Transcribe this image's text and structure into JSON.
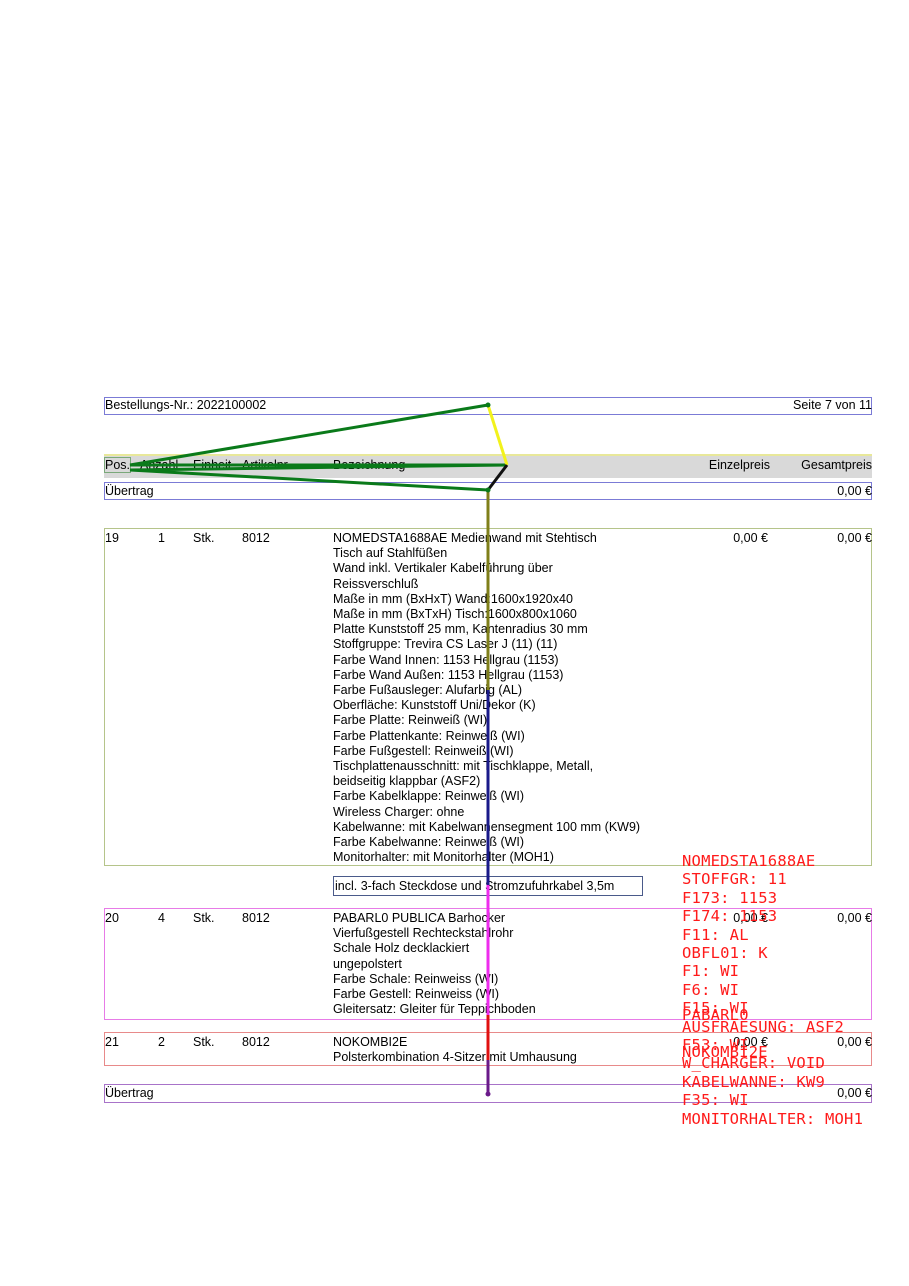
{
  "header": {
    "order_label": "Bestellungs-Nr.: 2022100002",
    "page_label": "Seite 7 von 11"
  },
  "table_header": {
    "pos": "Pos.",
    "anzahl": "Anzahl",
    "einheit": "Einheit",
    "artikelnr": "Artikelnr.",
    "bezeichnung": "Bezeichnung",
    "einzelpreis": "Einzelpreis",
    "gesamtpreis": "Gesamtpreis"
  },
  "carry_top": {
    "label": "Übertrag",
    "value": "0,00 €"
  },
  "items": [
    {
      "pos": "19",
      "qty": "1",
      "unit": "Stk.",
      "article": "8012",
      "unit_price": "0,00 €",
      "total": "0,00 €",
      "lines": [
        "NOMEDSTA1688AE Medienwand mit Stehtisch",
        "Tisch auf Stahlfüßen",
        "Wand inkl. Vertikaler Kabelführung über",
        "Reissverschluß",
        "Maße in mm (BxHxT) Wand:1600x1920x40",
        "Maße in mm (BxTxH) Tisch:1600x800x1060",
        "Platte Kunststoff 25 mm, Kantenradius 30 mm",
        "Stoffgruppe: Trevira CS Laser J (11) (11)",
        "Farbe Wand Innen: 1153 Hellgrau (1153)",
        "Farbe Wand Außen: 1153 Hellgrau (1153)",
        "Farbe Fußausleger: Alufarbig (AL)",
        "Oberfläche: Kunststoff Uni/Dekor (K)",
        "Farbe Platte: Reinweiß (WI)",
        "Farbe Plattenkante: Reinweiß (WI)",
        "Farbe Fußgestell: Reinweiß (WI)",
        "Tischplattenausschnitt: mit Tischklappe, Metall,",
        "beidseitig klappbar (ASF2)",
        "Farbe Kabelklappe: Reinweiß (WI)",
        "Wireless Charger: ohne",
        "Kabelwanne: mit Kabelwannensegment 100 mm (KW9)",
        "Farbe Kabelwanne: Reinweiß (WI)",
        "Monitorhalter: mit Monitorhalter (MOH1)"
      ],
      "note": "incl. 3-fach Steckdose und Stromzufuhrkabel 3,5m"
    },
    {
      "pos": "20",
      "qty": "4",
      "unit": "Stk.",
      "article": "8012",
      "unit_price": "0,00 €",
      "total": "0,00 €",
      "lines": [
        "PABARL0 PUBLICA Barhocker",
        "Vierfußgestell Rechteckstahlrohr",
        "Schale Holz decklackiert",
        "ungepolstert",
        "Farbe Schale: Reinweiss (WI)",
        "Farbe Gestell: Reinweiss (WI)",
        "Gleitersatz: Gleiter für Teppichboden"
      ]
    },
    {
      "pos": "21",
      "qty": "2",
      "unit": "Stk.",
      "article": "8012",
      "unit_price": "0,00 €",
      "total": "0,00 €",
      "lines": [
        "NOKOMBI2E",
        "Polsterkombination 4-Sitzer mit Umhausung"
      ]
    }
  ],
  "carry_bottom": {
    "label": "Übertrag",
    "value": "0,00 €"
  },
  "overlay_text": {
    "block1": [
      "NOMEDSTA1688AE",
      "STOFFGR: 11",
      "F173: 1153",
      "F174: 1153",
      "F11: AL",
      "OBFL01: K",
      "F1: WI",
      "F6: WI",
      "F15: WI",
      "AUSFRAESUNG: ASF2",
      "F53: WI",
      "W_CHARGER: VOID",
      "KABELWANNE: KW9",
      "F35: WI",
      "MONITORHALTER: MOH1"
    ],
    "block2": [
      "PABARL0"
    ],
    "block3": [
      "NOKOMBI2E"
    ]
  },
  "colors": {
    "frame_blue": "#7b7bd6",
    "frame_olive": "#b5c48a",
    "frame_magenta": "#e77be7",
    "frame_red": "#e88a8a",
    "frame_purple": "#a873c9",
    "header_fill": "#d9d9d9",
    "overlay_red": "#ff1a1a",
    "line_green": "#0a7a1a",
    "line_yellow": "#f2f21c"
  }
}
